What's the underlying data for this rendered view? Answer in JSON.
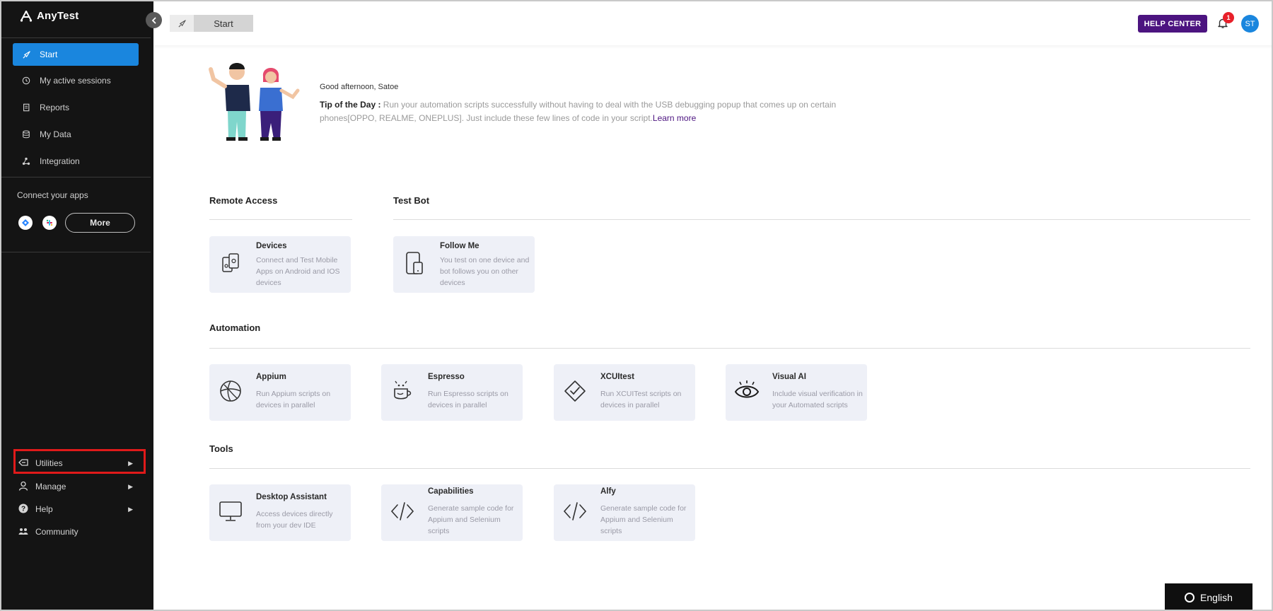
{
  "brand": {
    "name": "AnyTest"
  },
  "sidebar": {
    "nav": [
      {
        "label": "Start",
        "icon": "rocket-icon",
        "active": true
      },
      {
        "label": "My active sessions",
        "icon": "clock-icon",
        "active": false
      },
      {
        "label": "Reports",
        "icon": "report-icon",
        "active": false
      },
      {
        "label": "My Data",
        "icon": "database-icon",
        "active": false
      },
      {
        "label": "Integration",
        "icon": "integration-icon",
        "active": false
      }
    ],
    "connect_label": "Connect your apps",
    "more_label": "More",
    "bottom": [
      {
        "label": "Utilities",
        "icon": "utilities-icon",
        "has_submenu": true
      },
      {
        "label": "Manage",
        "icon": "user-icon",
        "has_submenu": true
      },
      {
        "label": "Help",
        "icon": "question-icon",
        "has_submenu": true
      },
      {
        "label": "Community",
        "icon": "community-icon",
        "has_submenu": false
      }
    ]
  },
  "topbar": {
    "breadcrumb": "Start",
    "help_center": "HELP CENTER",
    "notification_count": "1",
    "avatar_initials": "ST"
  },
  "greeting": {
    "text": "Good afternoon, Satoe",
    "tip_label": "Tip of the Day :",
    "tip_text": " Run your automation scripts successfully without having to deal with the USB debugging popup that comes up on certain phones[OPPO, REALME, ONEPLUS]. Just include these few lines of code in your script.",
    "learn_more": "Learn more"
  },
  "sections": {
    "remote_access": {
      "title": "Remote Access",
      "cards": [
        {
          "title": "Devices",
          "desc": "Connect and Test Mobile Apps on Android and IOS devices",
          "icon": "devices-icon"
        }
      ]
    },
    "test_bot": {
      "title": "Test Bot",
      "cards": [
        {
          "title": "Follow Me",
          "desc": "You test on one device and bot follows you on other devices",
          "icon": "follow-me-icon"
        }
      ]
    },
    "automation": {
      "title": "Automation",
      "cards": [
        {
          "title": "Appium",
          "desc": "Run Appium scripts on devices in parallel",
          "icon": "appium-icon"
        },
        {
          "title": "Espresso",
          "desc": "Run Espresso scripts on devices in parallel",
          "icon": "espresso-icon"
        },
        {
          "title": "XCUItest",
          "desc": "Run XCUITest scripts on devices in parallel",
          "icon": "xcuitest-icon"
        },
        {
          "title": "Visual AI",
          "desc": "Include visual verification in your Automated scripts",
          "icon": "eye-icon"
        }
      ]
    },
    "tools": {
      "title": "Tools",
      "cards": [
        {
          "title": "Desktop Assistant",
          "desc": "Access devices directly from your dev IDE",
          "icon": "monitor-icon"
        },
        {
          "title": "Capabilities",
          "desc": "Generate sample code for Appium and Selenium scripts",
          "icon": "code-icon"
        },
        {
          "title": "Alfy",
          "desc": "Generate sample code for Appium and Selenium scripts",
          "icon": "code-icon"
        }
      ]
    }
  },
  "language": {
    "label": "English"
  },
  "colors": {
    "sidebar_bg": "#141414",
    "active": "#1a86de",
    "help_center": "#4c1480",
    "card_bg": "#eef0f7",
    "badge": "#e8202a"
  }
}
